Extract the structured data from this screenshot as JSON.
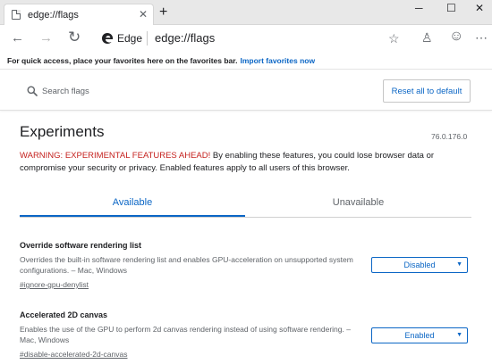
{
  "tab": {
    "title": "edge://flags",
    "close": "✕",
    "new_tab": "+"
  },
  "window": {
    "minimize": "─",
    "maximize": "☐",
    "close": "✕"
  },
  "toolbar": {
    "back": "←",
    "forward": "→",
    "refresh": "↻",
    "site_label": "Edge",
    "url": "edge://flags",
    "favorite": "☆",
    "profile": "♙",
    "emoji": "☺",
    "more": "⋯"
  },
  "favorites_bar": {
    "text": "For quick access, place your favorites here on the favorites bar.",
    "link": "Import favorites now"
  },
  "search": {
    "placeholder": "Search flags",
    "reset_label": "Reset all to default"
  },
  "page": {
    "title": "Experiments",
    "version": "76.0.176.0",
    "warning_strong": "WARNING: EXPERIMENTAL FEATURES AHEAD!",
    "warning_rest": " By enabling these features, you could lose browser data or compromise your security or privacy. Enabled features apply to all users of this browser."
  },
  "tabs": {
    "available": "Available",
    "unavailable": "Unavailable"
  },
  "experiments": [
    {
      "name": "Override software rendering list",
      "description": "Overrides the built-in software rendering list and enables GPU-acceleration on unsupported system configurations. – Mac, Windows",
      "link": "#ignore-gpu-denylist",
      "value": "Disabled"
    },
    {
      "name": "Accelerated 2D canvas",
      "description": "Enables the use of the GPU to perform 2d canvas rendering instead of using software rendering. – Mac, Windows",
      "link": "#disable-accelerated-2d-canvas",
      "value": "Enabled"
    }
  ],
  "colors": {
    "accent": "#0b66c5",
    "warning": "#c5221f",
    "tabbar": "#e8e8e8"
  }
}
